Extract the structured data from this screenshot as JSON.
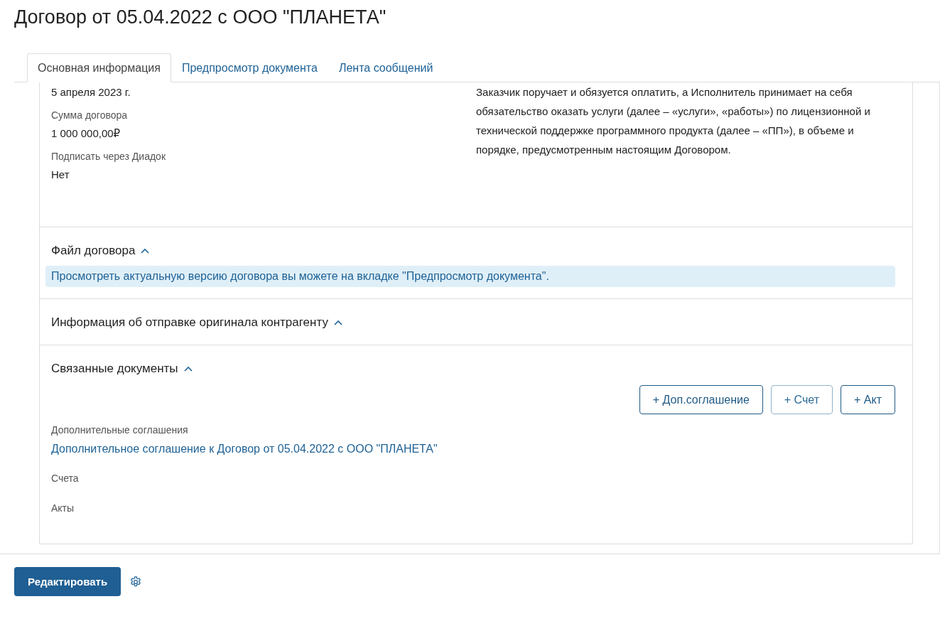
{
  "title": "Договор от 05.04.2022 с ООО \"ПЛАНЕТА\"",
  "tabs": [
    {
      "label": "Основная информация",
      "selected": true
    },
    {
      "label": "Предпросмотр документа",
      "selected": false
    },
    {
      "label": "Лента сообщений",
      "selected": false
    }
  ],
  "details": {
    "left": [
      {
        "kind": "value",
        "text": "5 апреля 2023 г."
      },
      {
        "kind": "label",
        "text": "Сумма договора"
      },
      {
        "kind": "value",
        "text": "1 000 000,00₽"
      },
      {
        "kind": "label",
        "text": "Подписать через Диадок"
      },
      {
        "kind": "value",
        "text": "Нет"
      }
    ],
    "description": "Заказчик поручает и обязуется оплатить, а Исполнитель принимает на себя обязательство оказать услуги (далее – «услуги», «работы») по лицензионной и технической поддержке программного продукта (далее – «ПП»), в объеме и порядке, предусмотренным настоящим Договором."
  },
  "sections": [
    {
      "title": "Файл договора",
      "expanded": true,
      "notice": "Просмотреть актуальную версию договора вы можете на вкладке \"Предпросмотр документа\"."
    },
    {
      "title": "Информация об отправке оригинала контрагенту",
      "expanded": true
    },
    {
      "title": "Связанные документы",
      "expanded": true,
      "buttons": [
        {
          "label": "+ Доп.соглашение",
          "hovered": false
        },
        {
          "label": "+ Счет",
          "hovered": true
        },
        {
          "label": "+ Акт",
          "hovered": false
        }
      ],
      "groups": [
        {
          "label": "Дополнительные соглашения",
          "links": [
            "Дополнительное соглашение к Договор от 05.04.2022 с ООО \"ПЛАНЕТА\""
          ]
        },
        {
          "label": "Счета"
        },
        {
          "label": "Акты"
        }
      ]
    }
  ],
  "footer": {
    "button": "Редактировать"
  }
}
